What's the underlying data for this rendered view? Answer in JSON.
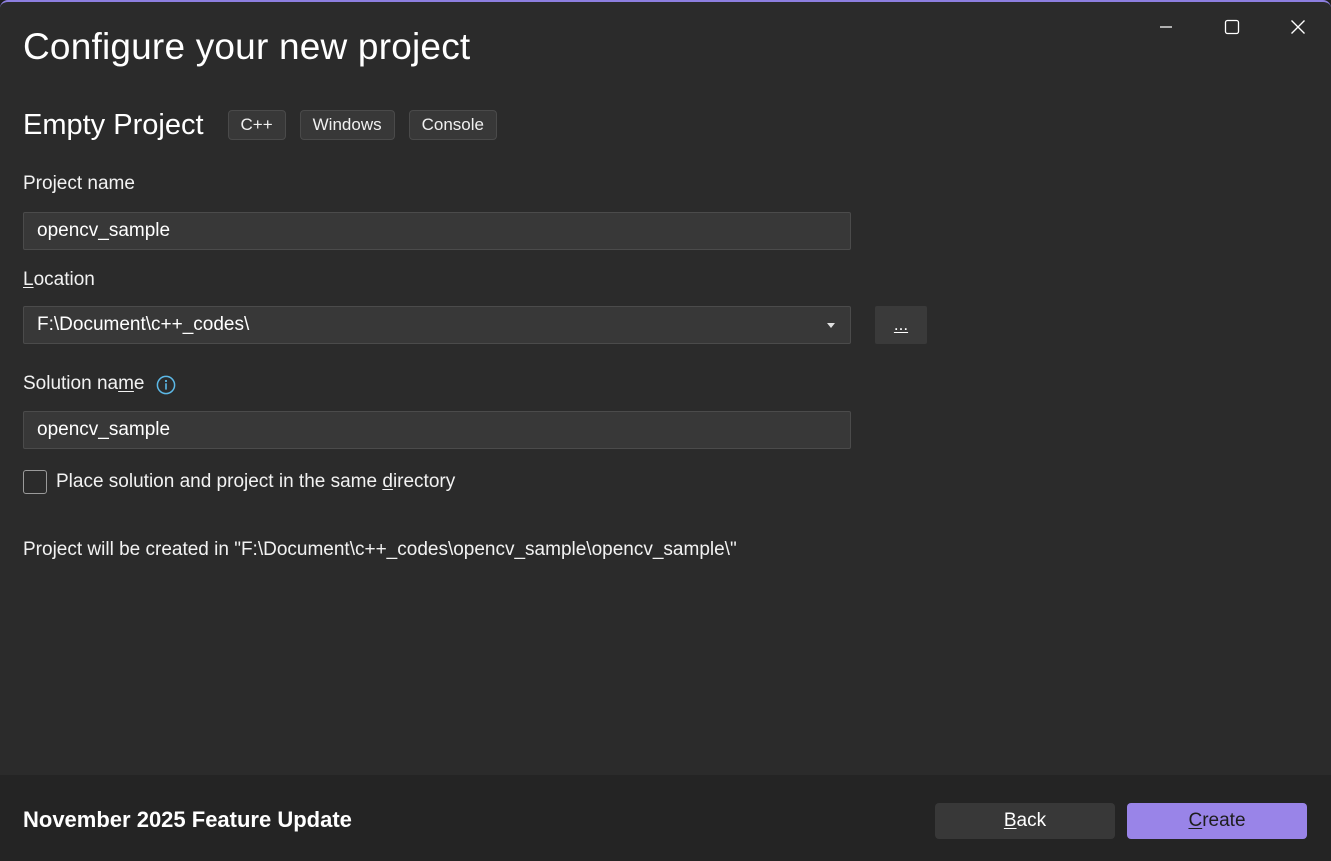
{
  "window": {
    "title": "Configure your new project",
    "controls": [
      "minimize-icon",
      "maximize-icon",
      "close-icon"
    ]
  },
  "template": {
    "name": "Empty Project",
    "tags": [
      "C++",
      "Windows",
      "Console"
    ]
  },
  "form": {
    "project_name": {
      "label": "Project name",
      "value": "opencv_sample"
    },
    "location": {
      "label_prefix": "",
      "label_accel": "L",
      "label_rest": "ocation",
      "value": "F:\\Document\\c++_codes\\",
      "browse_label": "..."
    },
    "solution_name": {
      "label_prefix": "Solution na",
      "label_accel": "m",
      "label_rest": "e",
      "value": "opencv_sample",
      "info_icon": "info-icon"
    },
    "same_directory": {
      "label_prefix": "Place solution and project in the same ",
      "label_accel": "d",
      "label_rest": "irectory",
      "checked": false
    },
    "path_note": "Project will be created in \"F:\\Document\\c++_codes\\opencv_sample\\opencv_sample\\\""
  },
  "footer": {
    "version": "November 2025 Feature Update",
    "back": {
      "accel": "B",
      "rest": "ack"
    },
    "create": {
      "accel": "C",
      "rest": "reate"
    }
  },
  "colors": {
    "accent": "#9984e8",
    "window_border": "#8d7fe0",
    "info_icon": "#5cb8e6"
  }
}
